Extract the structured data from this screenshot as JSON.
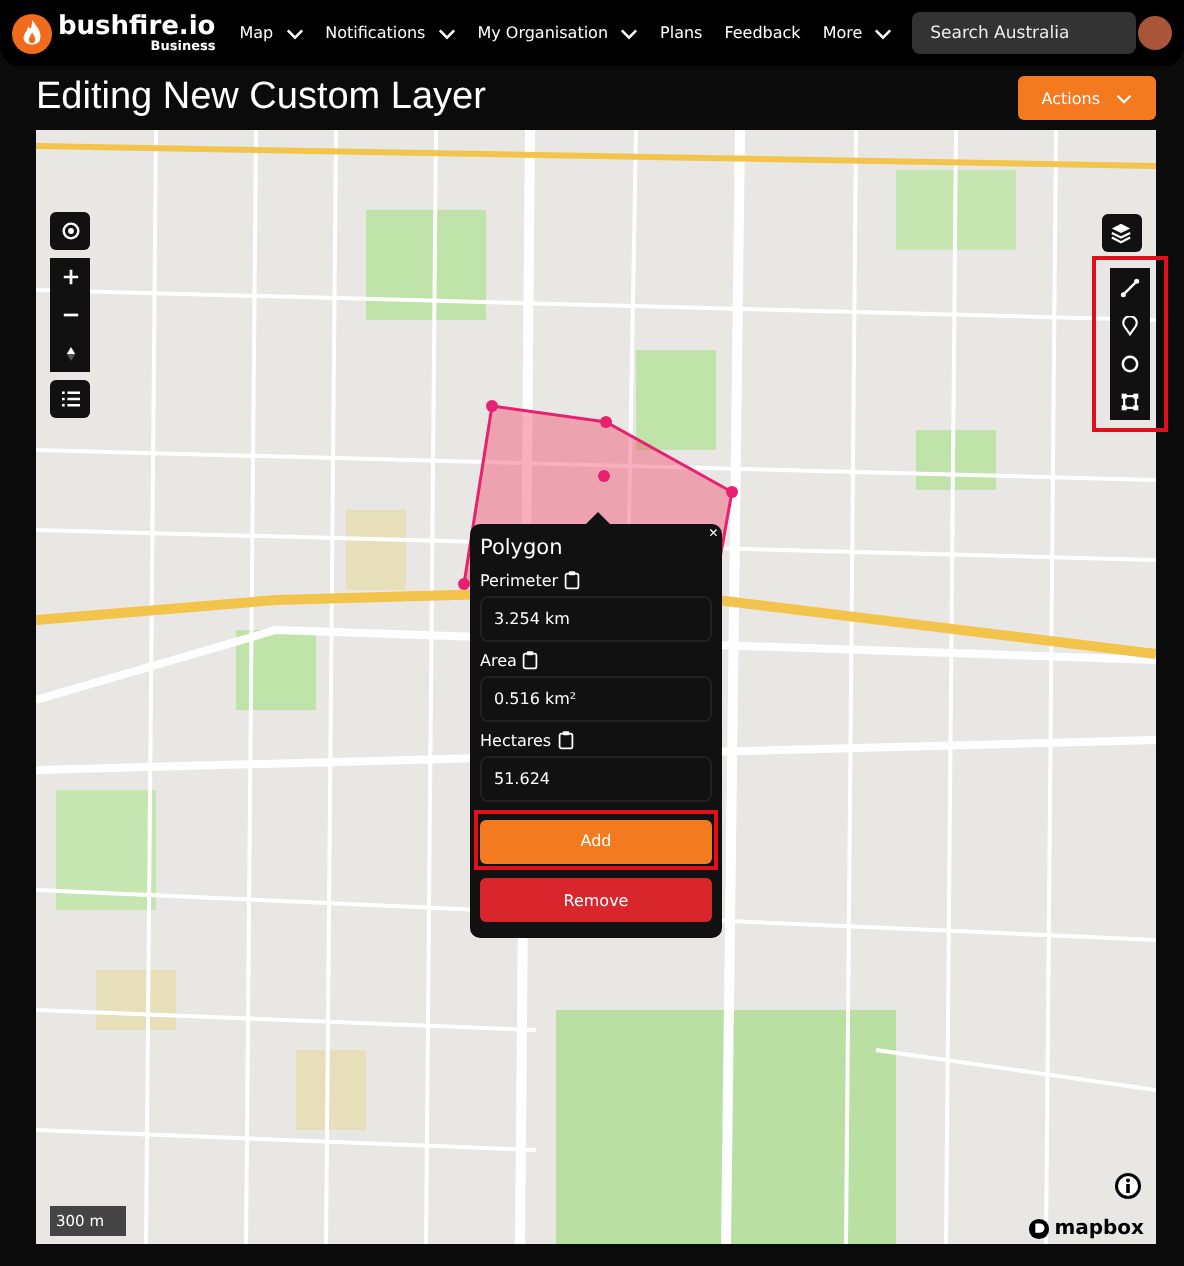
{
  "nav": {
    "brand": "bushfire.io",
    "brand_sub": "Business",
    "items": [
      {
        "label": "Map",
        "dropdown": true
      },
      {
        "label": "Notifications",
        "dropdown": true
      },
      {
        "label": "My Organisation",
        "dropdown": true
      },
      {
        "label": "Plans",
        "dropdown": false
      },
      {
        "label": "Feedback",
        "dropdown": false
      },
      {
        "label": "More",
        "dropdown": true
      }
    ],
    "search": {
      "placeholder": "Search Australia"
    }
  },
  "page": {
    "title": "Editing New Custom Layer",
    "actions": "Actions"
  },
  "map": {
    "scale": "300 m",
    "attribution": "mapbox",
    "draw_tools_highlighted": true,
    "popup": {
      "title": "Polygon",
      "close": "×",
      "fields": [
        {
          "label": "Perimeter",
          "value": "3.254 km"
        },
        {
          "label": "Area",
          "value": "0.516 km²"
        },
        {
          "label": "Hectares",
          "value": "51.624"
        }
      ],
      "buttons": [
        {
          "label": "Add",
          "kind": "primary",
          "highlighted": true
        },
        {
          "label": "Remove",
          "kind": "danger",
          "highlighted": false
        }
      ]
    }
  }
}
